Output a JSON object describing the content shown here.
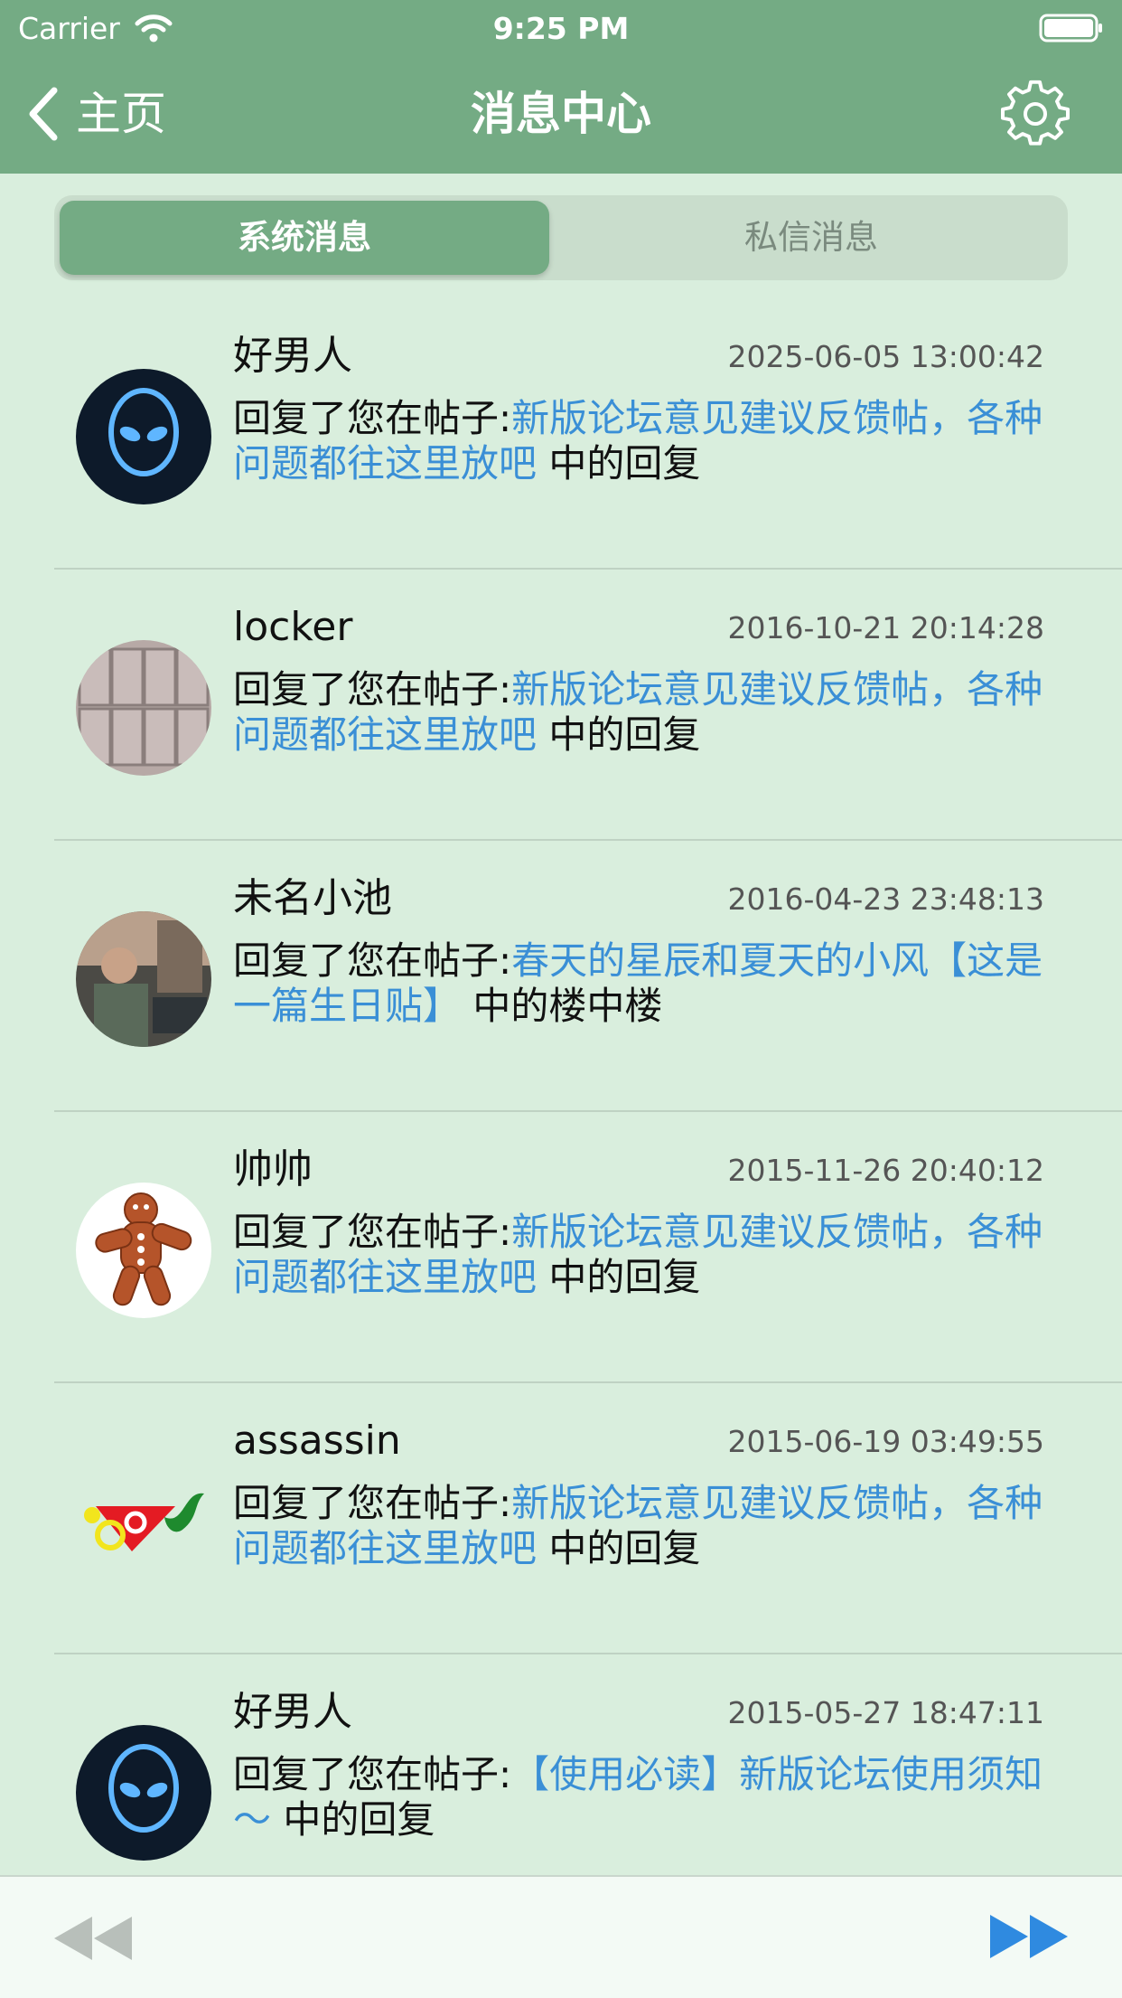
{
  "status": {
    "carrier": "Carrier",
    "time": "9:25 PM"
  },
  "nav": {
    "back_label": "主页",
    "title": "消息中心"
  },
  "tabs": {
    "active": "系统消息",
    "inactive": "私信消息"
  },
  "messages": [
    {
      "user": "好男人",
      "time": "2025-06-05 13:00:42",
      "prefix": "回复了您在帖子:",
      "link": "新版论坛意见建议反馈帖，各种问题都往这里放吧",
      "suffix": " 中的回复",
      "avatar": "alienware"
    },
    {
      "user": "locker",
      "time": "2016-10-21 20:14:28",
      "prefix": "回复了您在帖子:",
      "link": "新版论坛意见建议反馈帖，各种问题都往这里放吧",
      "suffix": " 中的回复",
      "avatar": "lockers"
    },
    {
      "user": "未名小池",
      "time": "2016-04-23 23:48:13",
      "prefix": "回复了您在帖子:",
      "link": "春天的星辰和夏天的小风【这是一篇生日贴】",
      "suffix": " 中的楼中楼",
      "avatar": "street-photo"
    },
    {
      "user": "帅帅",
      "time": "2015-11-26 20:40:12",
      "prefix": "回复了您在帖子:",
      "link": "新版论坛意见建议反馈帖，各种问题都往这里放吧",
      "suffix": " 中的回复",
      "avatar": "gingerbread"
    },
    {
      "user": "assassin",
      "time": "2015-06-19 03:49:55",
      "prefix": "回复了您在帖子:",
      "link": "新版论坛意见建议反馈帖，各种问题都往这里放吧",
      "suffix": " 中的回复",
      "avatar": "logo"
    },
    {
      "user": "好男人",
      "time": "2015-05-27 18:47:11",
      "prefix": "回复了您在帖子:",
      "link": "【使用必读】新版论坛使用须知～",
      "suffix": " 中的回复",
      "avatar": "alienware"
    }
  ],
  "colors": {
    "header": "#74ab84",
    "background": "#d9eedd",
    "link": "#3a8fd6",
    "next_arrow": "#2f8ae0",
    "prev_arrow": "#b8bfba"
  }
}
